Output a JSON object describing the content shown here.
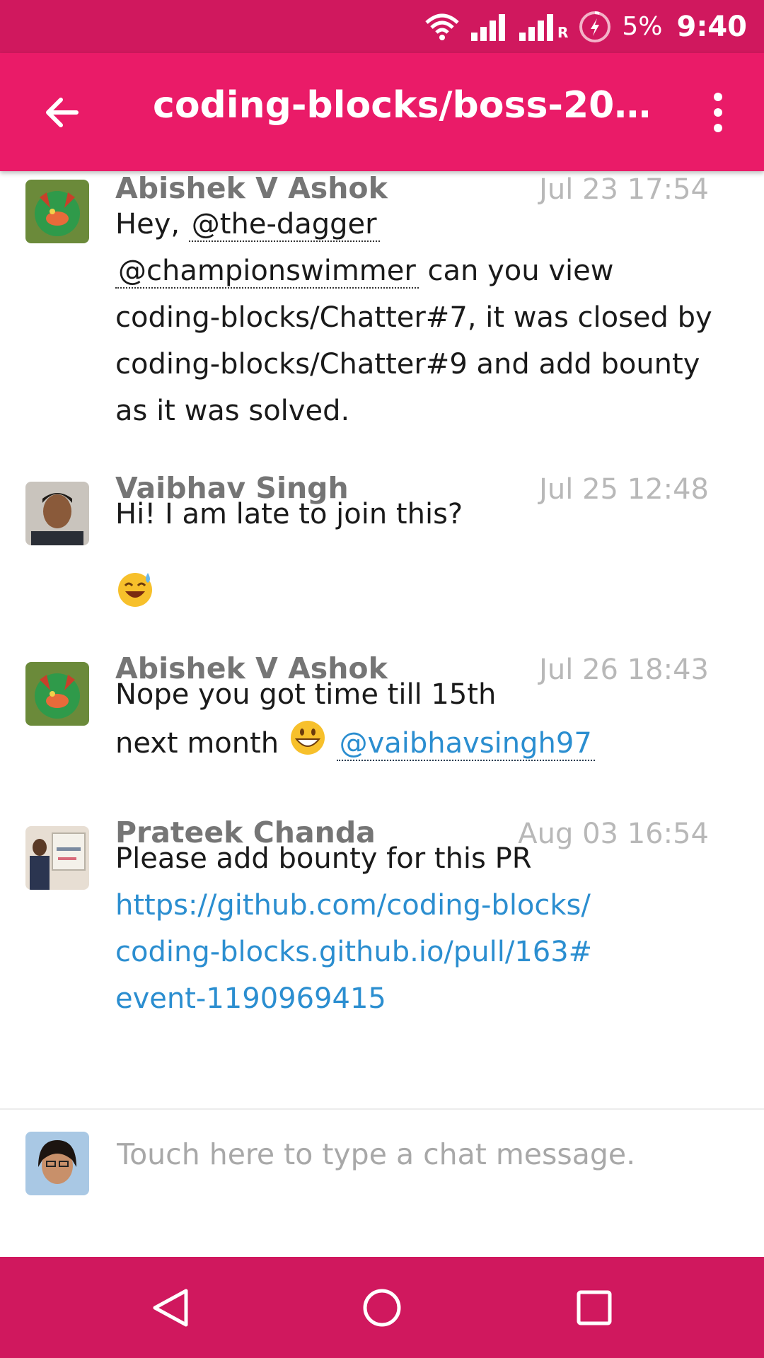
{
  "status_bar": {
    "battery": "5%",
    "time": "9:40",
    "roaming_marker": "R"
  },
  "app_bar": {
    "title": "coding-blocks/boss-20…"
  },
  "messages": [
    {
      "sender": "Abishek V Ashok",
      "time": "Jul 23 17:54",
      "text_before": "Hey,",
      "mention1": "@the-dagger",
      "mention2": "@championswimmer",
      "text_after": "can you view coding-blocks/Chatter#7, it was closed by coding-blocks/Chatter#9 and add bounty as it was solved."
    },
    {
      "sender": "Vaibhav Singh",
      "time": "Jul 25 12:48",
      "text": "Hi! I am late to join this?",
      "emoji": "smiling-face-with-sweat"
    },
    {
      "sender": "Abishek V Ashok",
      "time": "Jul 26 18:43",
      "line1": "Nope you got time till 15th",
      "line2": "next month",
      "emoji": "grinning-face",
      "mention": "@vaibhavsingh97"
    },
    {
      "sender": "Prateek Chanda",
      "time": "Aug 03 16:54",
      "text": "Please add bounty for this PR",
      "link": "https://github.com/coding-blocks/coding-blocks.github.io/pull/163#event-1190969415"
    }
  ],
  "composer": {
    "placeholder": "Touch here to type a chat message."
  },
  "colors": {
    "status_bar": "#d0185e",
    "app_bar": "#ea1b68",
    "link": "#2b8ed0"
  }
}
